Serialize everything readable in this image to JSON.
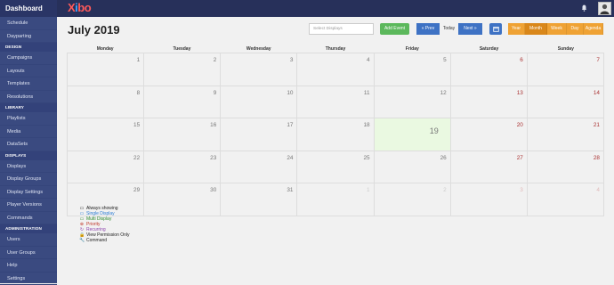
{
  "sidebar": {
    "header": "Dashboard",
    "sections": [
      {
        "title": "",
        "items": [
          "Schedule",
          "Dayparting"
        ]
      },
      {
        "title": "DESIGN",
        "items": [
          "Campaigns",
          "Layouts",
          "Templates",
          "Resolutions"
        ]
      },
      {
        "title": "LIBRARY",
        "items": [
          "Playlists",
          "Media",
          "DataSets"
        ]
      },
      {
        "title": "DISPLAYS",
        "items": [
          "Displays",
          "Display Groups",
          "Display Settings",
          "Player Versions",
          "Commands"
        ]
      },
      {
        "title": "ADMINISTRATION",
        "items": [
          "Users",
          "User Groups",
          "Help",
          "Settings"
        ]
      }
    ]
  },
  "topbar": {
    "logo_x": "X",
    "logo_i": "i",
    "logo_bo": "bo"
  },
  "calendar": {
    "title": "July 2019",
    "search_placeholder": "Select Displays",
    "add_event": "Add Event",
    "prev": "« Prev",
    "today": "Today",
    "next": "Next »",
    "views": [
      "Year",
      "Month",
      "Week",
      "Day",
      "Agenda"
    ],
    "active_view": "Month",
    "weekdays": [
      "Monday",
      "Tuesday",
      "Wednesday",
      "Thursday",
      "Friday",
      "Saturday",
      "Sunday"
    ],
    "weeks": [
      [
        "1",
        "2",
        "3",
        "4",
        "5",
        "6",
        "7"
      ],
      [
        "8",
        "9",
        "10",
        "11",
        "12",
        "13",
        "14"
      ],
      [
        "15",
        "16",
        "17",
        "18",
        "19",
        "20",
        "21"
      ],
      [
        "22",
        "23",
        "24",
        "25",
        "26",
        "27",
        "28"
      ],
      [
        "29",
        "30",
        "31",
        "1",
        "2",
        "3",
        "4"
      ]
    ],
    "today_day": "19"
  },
  "legend": [
    {
      "icon": "desktop-icon",
      "glyph": "▭",
      "label": "Always showing",
      "color": "#222222"
    },
    {
      "icon": "single-display-icon",
      "glyph": "▭",
      "label": "Single Display",
      "color": "#2a7bd4"
    },
    {
      "icon": "multi-display-icon",
      "glyph": "▭",
      "label": "Multi Display",
      "color": "#2e8b2e"
    },
    {
      "icon": "priority-icon",
      "glyph": "⊕",
      "label": "Priority",
      "color": "#c0392b"
    },
    {
      "icon": "recurring-icon",
      "glyph": "↻",
      "label": "Recurring",
      "color": "#8e44ad"
    },
    {
      "icon": "lock-icon",
      "glyph": "🔒",
      "label": "View Permission Only",
      "color": "#222222"
    },
    {
      "icon": "wrench-icon",
      "glyph": "🔧",
      "label": "Command",
      "color": "#222222"
    }
  ],
  "colors": {
    "sidebar_bg": "#3a4a80",
    "topbar_bg": "#27305a",
    "add_event_green": "#5cb85c",
    "nav_blue": "#3e72c4",
    "view_orange": "#efa234",
    "view_active": "#d9871a"
  }
}
